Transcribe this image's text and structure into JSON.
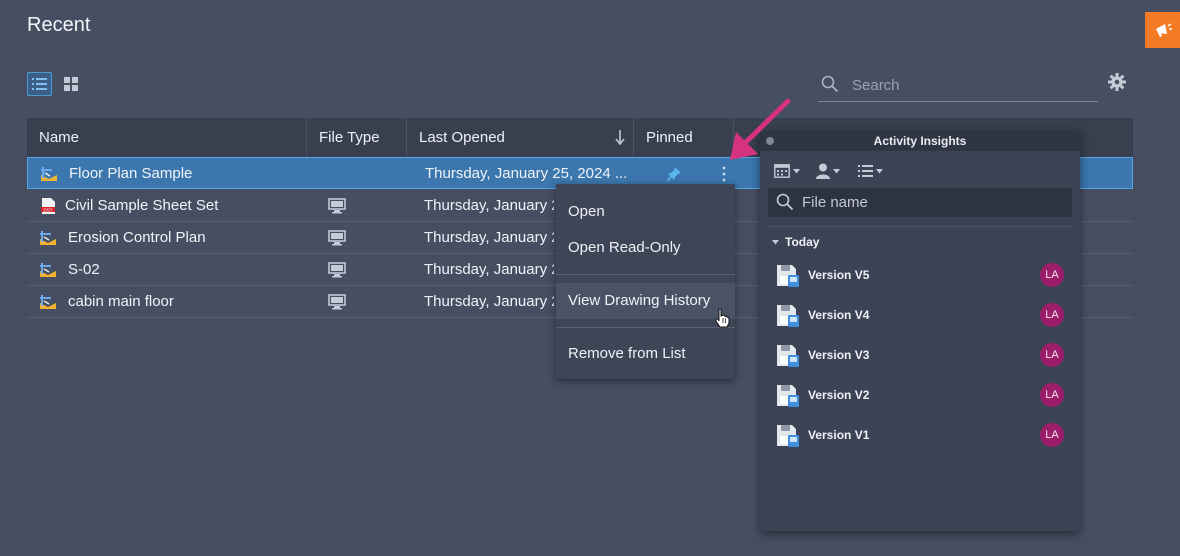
{
  "page": {
    "title": "Recent"
  },
  "toolbar": {
    "search_placeholder": "Search",
    "list_view_icon": "list-view-icon",
    "grid_view_icon": "grid-view-icon",
    "settings_icon": "gear-icon"
  },
  "table": {
    "columns": {
      "name": "Name",
      "file_type": "File Type",
      "last_opened": "Last Opened",
      "pinned": "Pinned"
    },
    "rows": [
      {
        "name": "Floor Plan Sample",
        "date": "Thursday, January 25, 2024 ...",
        "icon": "drawing-file-icon",
        "pinned": true,
        "selected": true
      },
      {
        "name": "Civil Sample Sheet Set",
        "date": "Thursday, January 2",
        "icon": "dst-file-icon",
        "type_icon": "desktop-icon"
      },
      {
        "name": "Erosion Control Plan",
        "date": "Thursday, January 2",
        "icon": "drawing-file-icon",
        "type_icon": "desktop-icon"
      },
      {
        "name": "S-02",
        "date": "Thursday, January 2",
        "icon": "drawing-file-icon",
        "type_icon": "desktop-icon"
      },
      {
        "name": "cabin main floor",
        "date": "Thursday, January 2",
        "icon": "drawing-file-icon",
        "type_icon": "desktop-icon"
      }
    ]
  },
  "context_menu": {
    "items": [
      "Open",
      "Open Read-Only",
      "View Drawing History",
      "Remove from List"
    ],
    "hovered": "View Drawing History"
  },
  "activity_panel": {
    "title": "Activity Insights",
    "search_placeholder": "File name",
    "group_label": "Today",
    "versions": [
      {
        "label": "Version V5",
        "user": "LA"
      },
      {
        "label": "Version V4",
        "user": "LA"
      },
      {
        "label": "Version V3",
        "user": "LA"
      },
      {
        "label": "Version V2",
        "user": "LA"
      },
      {
        "label": "Version V1",
        "user": "LA"
      }
    ]
  },
  "colors": {
    "background": "#464f62",
    "selected_row": "#3b77ad",
    "accent_orange": "#f47b25",
    "annotation_arrow": "#d6337f",
    "avatar": "#9c1e6b"
  }
}
